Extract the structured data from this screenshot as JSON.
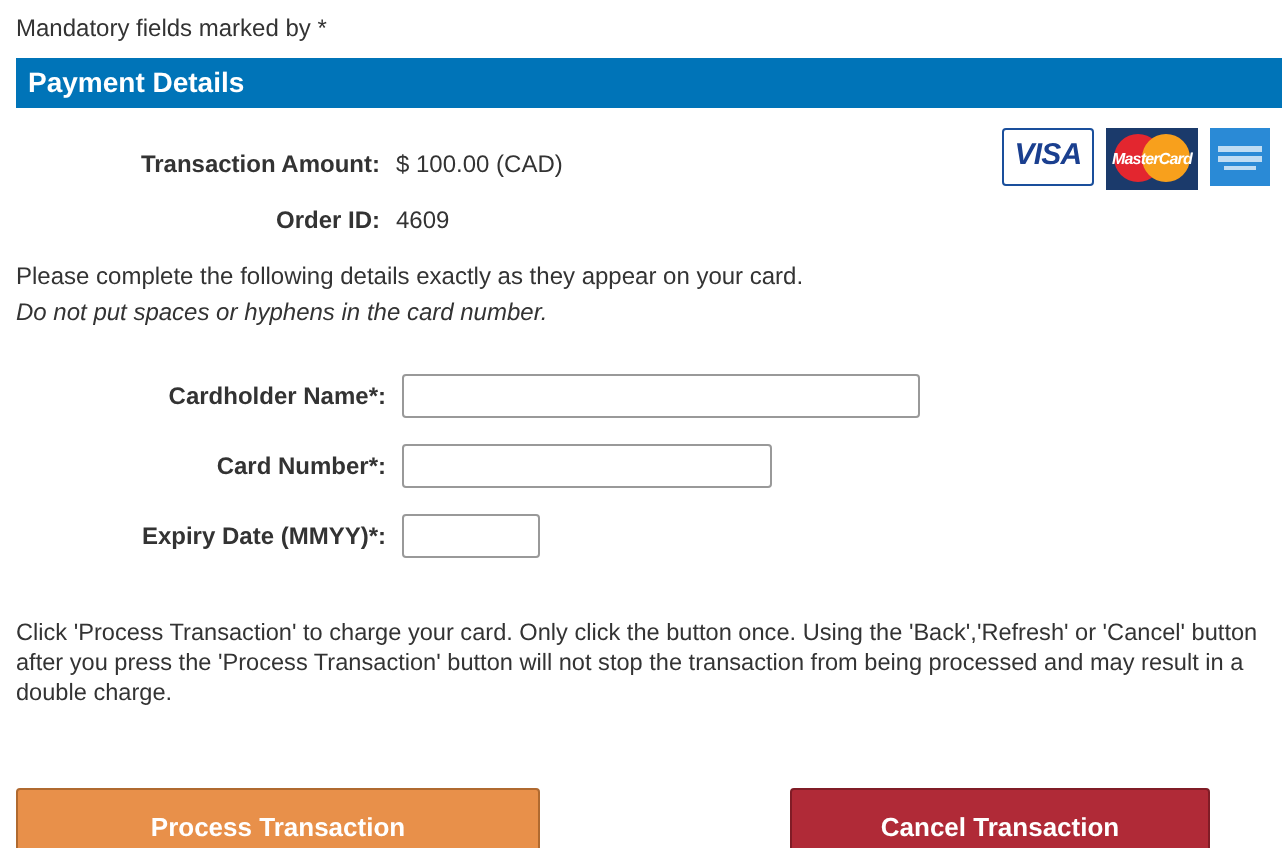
{
  "mandatory_note": "Mandatory fields marked by *",
  "section_title": "Payment Details",
  "summary": [
    {
      "label": "Transaction Amount:",
      "value": "$ 100.00 (CAD)"
    },
    {
      "label": "Order ID:",
      "value": "4609"
    }
  ],
  "card_logos": [
    {
      "kind": "visa",
      "label": "VISA"
    },
    {
      "kind": "mastercard",
      "label": "MasterCard"
    },
    {
      "kind": "amex"
    }
  ],
  "instructions": "Please complete the following details exactly as they appear on your card.",
  "instructions_note": "Do not put spaces or hyphens in the card number.",
  "fields": [
    {
      "label": "Cardholder Name*:",
      "kind": "long"
    },
    {
      "label": "Card Number*:",
      "kind": "medium"
    },
    {
      "label": "Expiry Date (MMYY)*:",
      "kind": "short"
    }
  ],
  "warning": "Click 'Process Transaction' to charge your card. Only click the button once. Using the 'Back','Refresh' or 'Cancel' button after you press the 'Process Transaction' button will not stop the transaction from being processed and may result in a double charge.",
  "buttons": [
    {
      "label": "Process Transaction",
      "kind": "primary"
    },
    {
      "label": "Cancel Transaction",
      "kind": "danger"
    }
  ]
}
